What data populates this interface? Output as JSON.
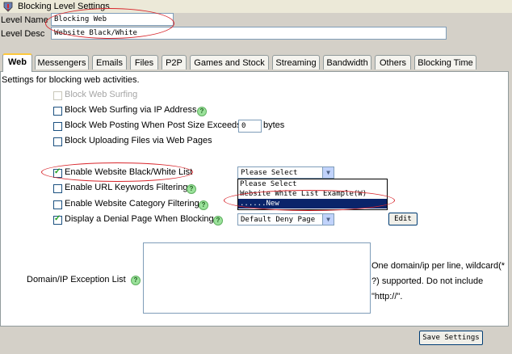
{
  "window": {
    "title": "Blocking Level Settings",
    "icon": "shield-warning-icon"
  },
  "fields": {
    "level_name_label": "Level Name",
    "level_name_value": "Blocking Web",
    "level_desc_label": "Level Desc",
    "level_desc_value": "Website Black/White"
  },
  "tabs": [
    {
      "label": "Web",
      "active": true
    },
    {
      "label": "Messengers"
    },
    {
      "label": "Emails"
    },
    {
      "label": "Files"
    },
    {
      "label": "P2P"
    },
    {
      "label": "Games and Stock"
    },
    {
      "label": "Streaming"
    },
    {
      "label": "Bandwidth"
    },
    {
      "label": "Others"
    },
    {
      "label": "Blocking Time"
    }
  ],
  "panel": {
    "description": "Settings for blocking web activities.",
    "options": [
      {
        "label": "Block Web Surfing",
        "checked": false,
        "disabled": true
      },
      {
        "label": "Block Web Surfing via IP Address",
        "checked": false
      },
      {
        "label": "Block Web Posting When Post Size Exceeds",
        "checked": false
      },
      {
        "label": "Block Uploading Files via Web Pages",
        "checked": false
      },
      {
        "label": "Enable Website Black/White List",
        "checked": true
      },
      {
        "label": "Enable URL Keywords Filtering",
        "checked": false
      },
      {
        "label": "Enable Website Category Filtering",
        "checked": false
      },
      {
        "label": "Display a Denial Page When Blocking",
        "checked": true
      }
    ],
    "post_size_value": "0",
    "post_size_unit": "bytes",
    "bw_select": {
      "selected": "Please Select",
      "options": [
        "Please Select",
        "Website White List Example(W)",
        "......New"
      ],
      "highlighted": "......New"
    },
    "deny_select": {
      "selected": "Default Deny Page"
    },
    "edit_button": "Edit",
    "exception_label": "Domain/IP Exception List",
    "exception_value": "",
    "exception_hint": "One domain/ip per line, wildcard(*?) supported. Do not include \"http://\".",
    "exception_hint_lines": [
      "One domain/ip per line, wildcard(*",
      "?) supported. Do not include",
      "\"http://\"."
    ]
  },
  "footer": {
    "save_button": "Save Settings"
  },
  "colors": {
    "annotation_ring": "#d8262c",
    "check": "#21a121",
    "highlight": "#0a246a"
  }
}
